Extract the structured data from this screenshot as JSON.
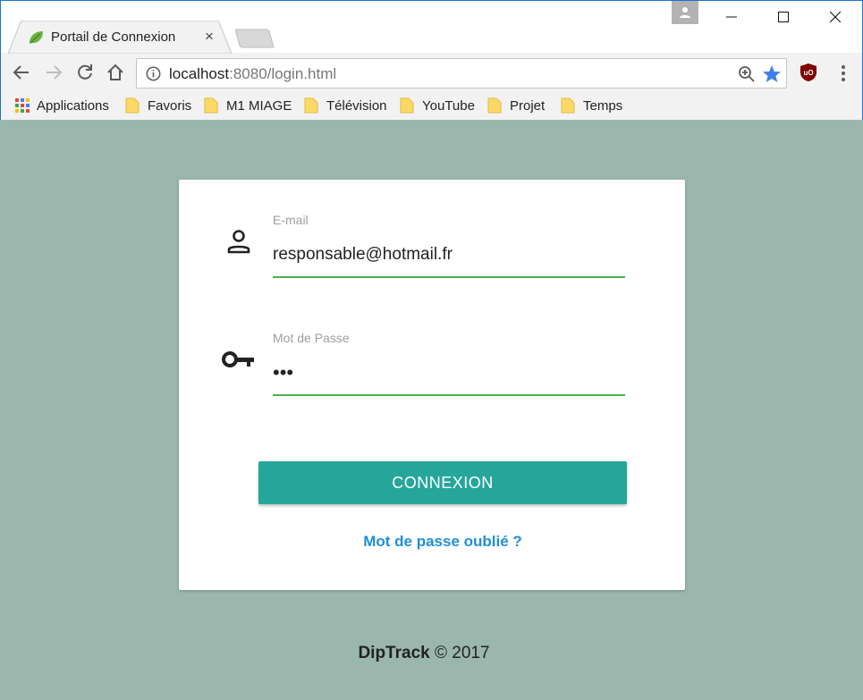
{
  "browser": {
    "tab_title": "Portail de Connexion",
    "tab_close": "×",
    "url_host": "localhost",
    "url_rest": ":8080/login.html",
    "window_controls": {
      "minimize": "—",
      "maximize": "☐",
      "close": "✕"
    }
  },
  "bookmarks": [
    {
      "label": "Applications",
      "icon": "apps-grid-icon"
    },
    {
      "label": "Favoris",
      "icon": "folder-icon"
    },
    {
      "label": "M1 MIAGE",
      "icon": "folder-icon"
    },
    {
      "label": "Télévision",
      "icon": "folder-icon"
    },
    {
      "label": "YouTube",
      "icon": "folder-icon"
    },
    {
      "label": "Projet",
      "icon": "folder-icon"
    },
    {
      "label": "Temps",
      "icon": "folder-icon"
    }
  ],
  "login": {
    "email_label": "E-mail",
    "email_value": "responsable@hotmail.fr",
    "password_label": "Mot de Passe",
    "password_value": "•••",
    "submit_label": "CONNEXION",
    "forgot_label": "Mot de passe oublié ?"
  },
  "footer": {
    "brand": "DipTrack",
    "copyright": "© 2017"
  },
  "colors": {
    "page_background": "#9bb7ad",
    "accent_button": "#26a69a",
    "input_underline": "#4caf50",
    "link": "#1e90d6"
  }
}
